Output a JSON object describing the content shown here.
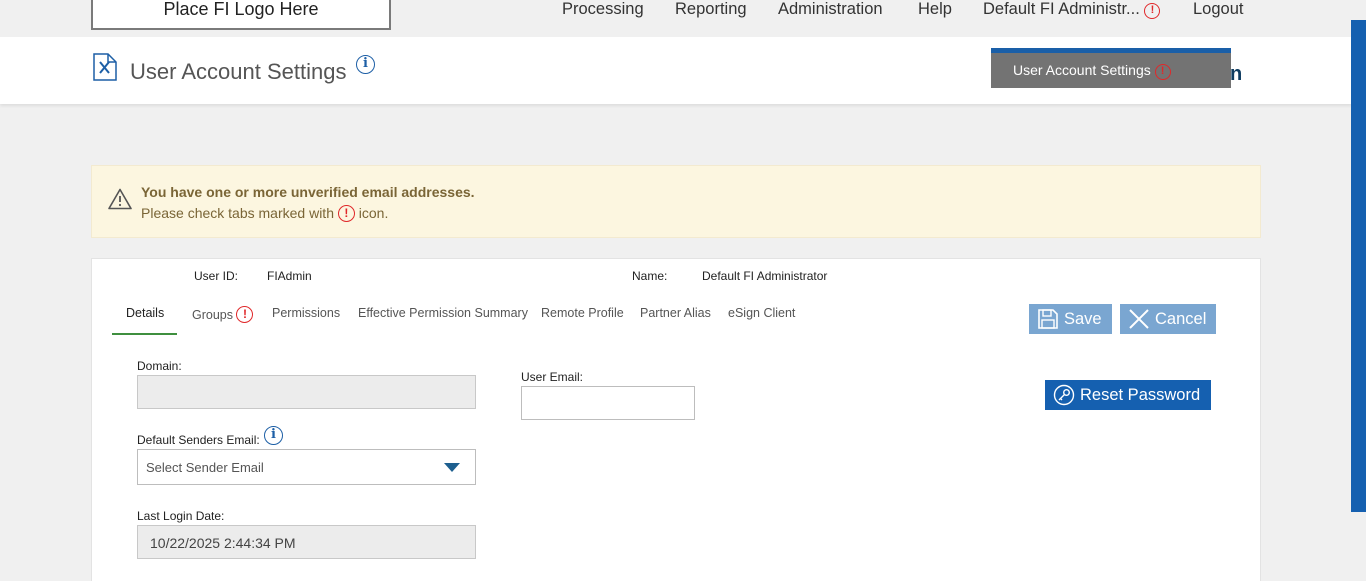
{
  "top_nav": {
    "logo_text": "Place FI Logo Here",
    "items": [
      "Processing",
      "Reporting",
      "Administration",
      "Help",
      "Default FI Administr...",
      "Logout"
    ]
  },
  "header": {
    "title": "User Account Settings",
    "menu_tab_label": "User Account Settings",
    "trail_text": "n"
  },
  "warning": {
    "title": "You have one or more unverified email addresses.",
    "text_before": "Please check tabs marked with",
    "text_after": "icon."
  },
  "user": {
    "id_label": "User ID:",
    "id_value": "FIAdmin",
    "name_label": "Name:",
    "name_value": "Default FI Administrator"
  },
  "tabs": [
    "Details",
    "Groups",
    "Permissions",
    "Effective Permission Summary",
    "Remote Profile",
    "Partner Alias",
    "eSign Client"
  ],
  "buttons": {
    "save": "Save",
    "cancel": "Cancel",
    "reset_password": "Reset Password"
  },
  "form": {
    "domain_label": "Domain:",
    "domain_value": "",
    "user_email_label": "User Email:",
    "user_email_value": "",
    "default_senders_label": "Default Senders Email:",
    "default_senders_placeholder": "Select Sender Email",
    "last_login_label": "Last Login Date:",
    "last_login_value": "10/22/2025 2:44:34 PM"
  },
  "colors": {
    "primary_blue": "#1560b0",
    "button_light_blue": "#7aa6d1",
    "alert_red": "#e0282a",
    "warning_bg": "#fcf6e0",
    "tab_underline": "#3f8f3f"
  }
}
